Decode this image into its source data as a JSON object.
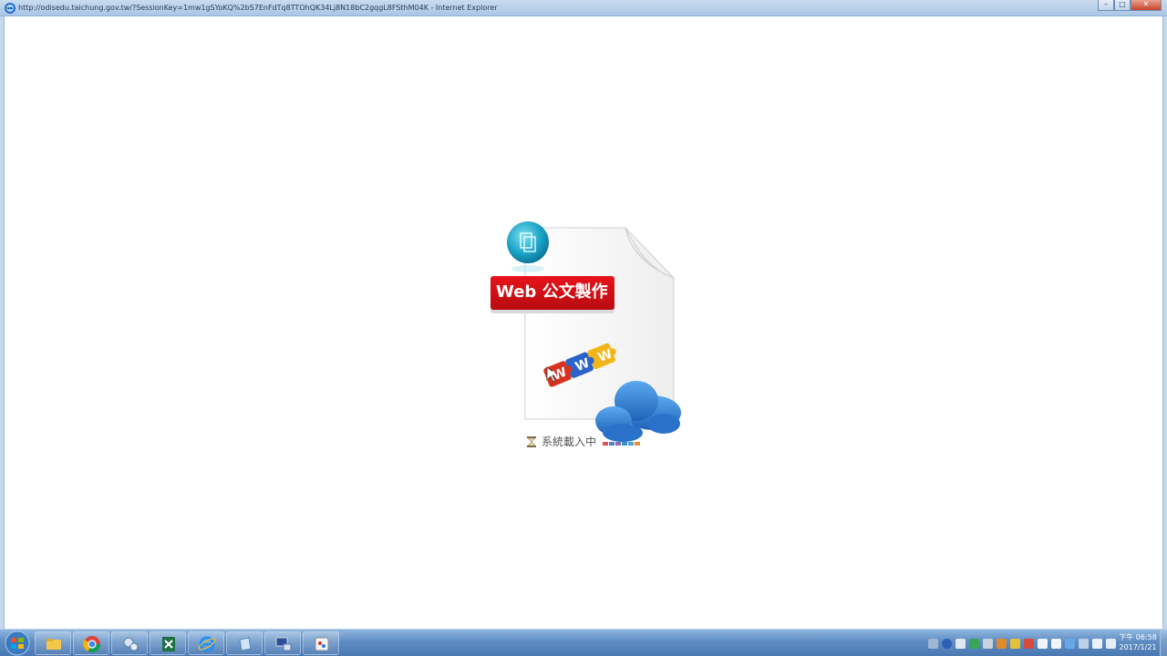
{
  "window": {
    "title": "http://odisedu.taichung.gov.tw/?SessionKey=1mw1gSYoKQ%2bS7EnFdTq8TTOhQK34Lj8N18bC2gqgL8FSthM04K - Internet Explorer",
    "controls": {
      "minimize": "–",
      "maximize": "□",
      "close": "✕"
    }
  },
  "page": {
    "banner_label": "Web 公文製作",
    "puzzle_letters": [
      "W",
      "W",
      "W"
    ],
    "loading_text": "系統載入中",
    "loading_dot_colors": [
      "#d9534f",
      "#5b7fc7",
      "#8a6fb5",
      "#3a8fd1",
      "#4aa8c7",
      "#e58a3a"
    ]
  },
  "taskbar": {
    "apps": [
      {
        "name": "explorer",
        "icon": "folder-icon"
      },
      {
        "name": "chrome",
        "icon": "chrome-icon"
      },
      {
        "name": "network",
        "icon": "network-icon"
      },
      {
        "name": "excel",
        "icon": "excel-icon"
      },
      {
        "name": "internet-explorer",
        "icon": "ie-icon"
      },
      {
        "name": "notes",
        "icon": "notes-icon"
      },
      {
        "name": "remote",
        "icon": "remote-icon"
      },
      {
        "name": "paint",
        "icon": "paint-icon"
      }
    ],
    "clock": {
      "time": "下午 06:58",
      "date": "2017/1/21"
    }
  },
  "colors": {
    "banner_red": "#d9101a",
    "taskbar_blue": "#5f8dc3",
    "cloud_blue": "#3b82d4"
  }
}
